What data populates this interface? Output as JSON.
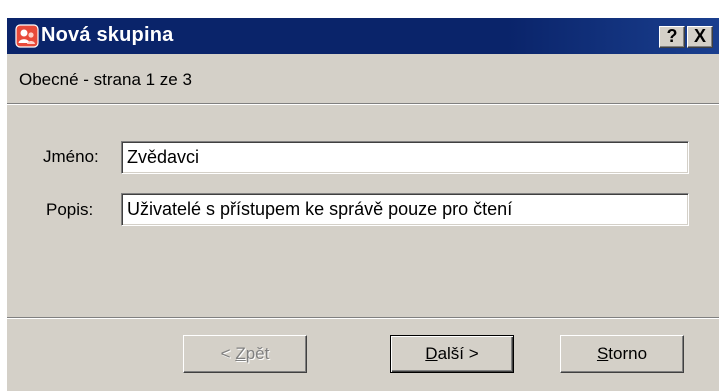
{
  "window": {
    "title": "Nová skupina",
    "help_label": "?",
    "close_label": "X"
  },
  "page": {
    "indicator": "Obecné - strana 1 ze 3"
  },
  "form": {
    "name_label": "Jméno:",
    "name_value": "Zvědavci",
    "description_label": "Popis:",
    "description_value": "Uživatelé s přístupem ke správě pouze pro čtení"
  },
  "buttons": {
    "back": {
      "accel": "Z",
      "rest_before": "< ",
      "rest_after": "pět",
      "enabled": false
    },
    "next": {
      "accel": "D",
      "rest_before": "",
      "rest_after": "alší >",
      "default": true
    },
    "cancel": {
      "accel": "S",
      "rest_before": "",
      "rest_after": "torno"
    }
  },
  "colors": {
    "title_bar": "#0a246a",
    "face": "#d4d0c8",
    "disabled_text": "#808080"
  }
}
